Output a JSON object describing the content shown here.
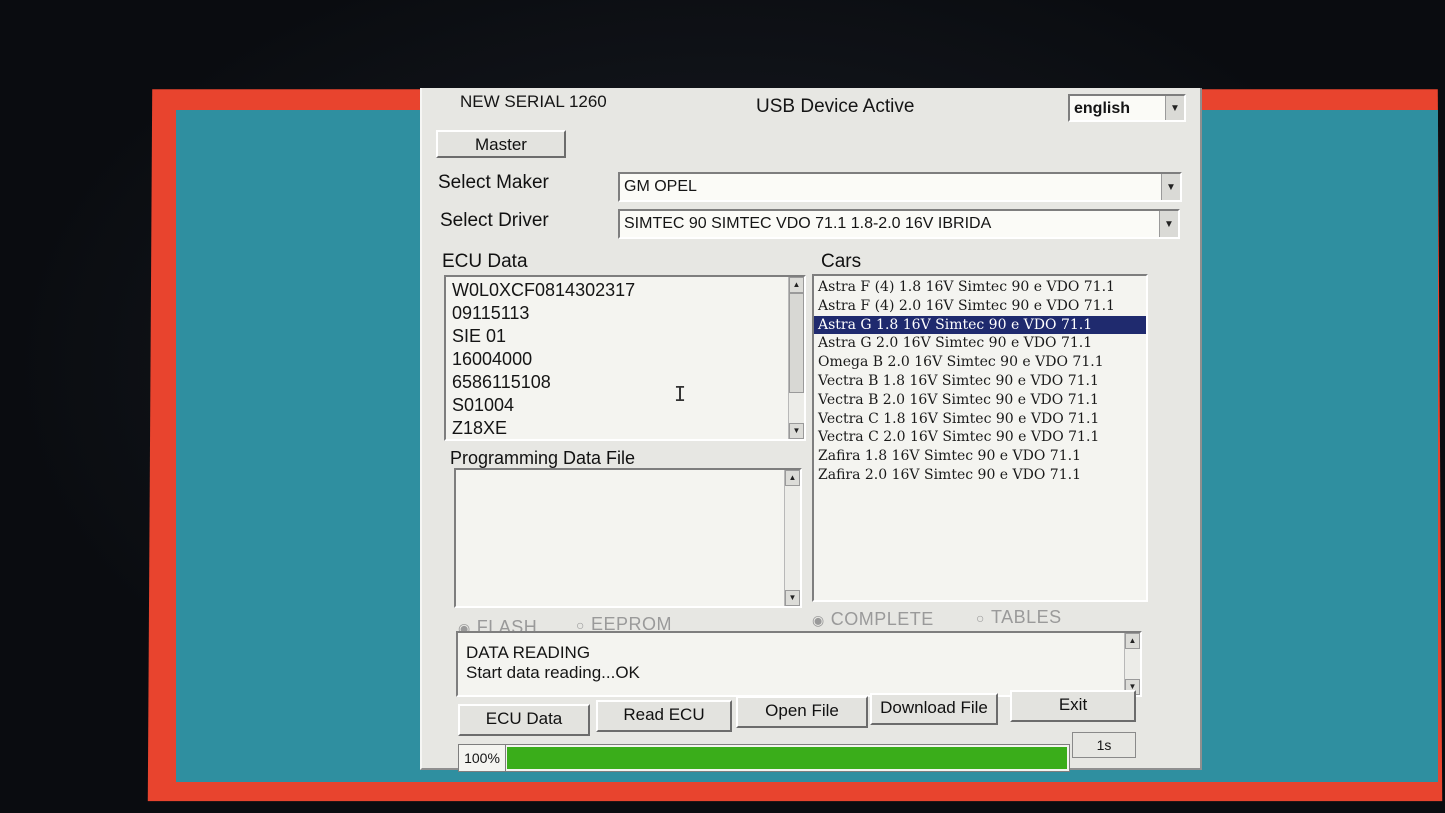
{
  "header": {
    "serial": "NEW SERIAL 1260",
    "usb_status": "USB Device Active",
    "language": "english",
    "master_button": "Master"
  },
  "selectors": {
    "maker_label": "Select Maker",
    "maker_value": "GM OPEL",
    "driver_label": "Select Driver",
    "driver_value": "SIMTEC 90 SIMTEC VDO 71.1 1.8-2.0 16V  IBRIDA"
  },
  "ecu_data": {
    "label": "ECU Data",
    "lines": [
      "W0L0XCF0814302317",
      "09115113",
      "SIE  01",
      "16004000",
      "6586115108",
      "S01004",
      "Z18XE"
    ]
  },
  "programming": {
    "label": "Programming Data File",
    "radio_flash": "FLASH",
    "radio_eeprom": "EEPROM",
    "selected": "FLASH"
  },
  "cars": {
    "label": "Cars",
    "items": [
      "Astra F (4) 1.8 16V Simtec 90 e VDO 71.1",
      "Astra F (4) 2.0 16V Simtec 90 e VDO 71.1",
      "Astra G 1.8 16V Simtec 90 e VDO 71.1",
      "Astra G 2.0 16V Simtec 90 e VDO 71.1",
      "Omega B 2.0 16V Simtec 90 e VDO 71.1",
      "Vectra B 1.8 16V Simtec 90 e VDO 71.1",
      "Vectra B 2.0 16V Simtec 90 e VDO 71.1",
      "Vectra C 1.8 16V Simtec 90 e VDO 71.1",
      "Vectra C 2.0 16V Simtec 90 e VDO 71.1",
      "Zafira 1.8 16V Simtec 90 e VDO 71.1",
      "Zafira 2.0 16V Simtec 90 e VDO 71.1"
    ],
    "selected_index": 2,
    "radio_complete": "COMPLETE",
    "radio_tables": "TABLES",
    "selected_mode": "COMPLETE"
  },
  "log": {
    "lines": [
      "DATA READING",
      "Start data reading...OK"
    ]
  },
  "buttons": {
    "ecu_data": "ECU Data",
    "read_ecu": "Read ECU",
    "open_file": "Open File",
    "download_file": "Download File",
    "exit": "Exit"
  },
  "progress": {
    "percent_label": "100%",
    "fraction": 1.0,
    "elapsed": "1s"
  },
  "colors": {
    "progress_fill": "#3aad1a",
    "selection": "#1f2a6e",
    "screen_border": "#e8442e",
    "desktop": "#2f8fa0"
  }
}
